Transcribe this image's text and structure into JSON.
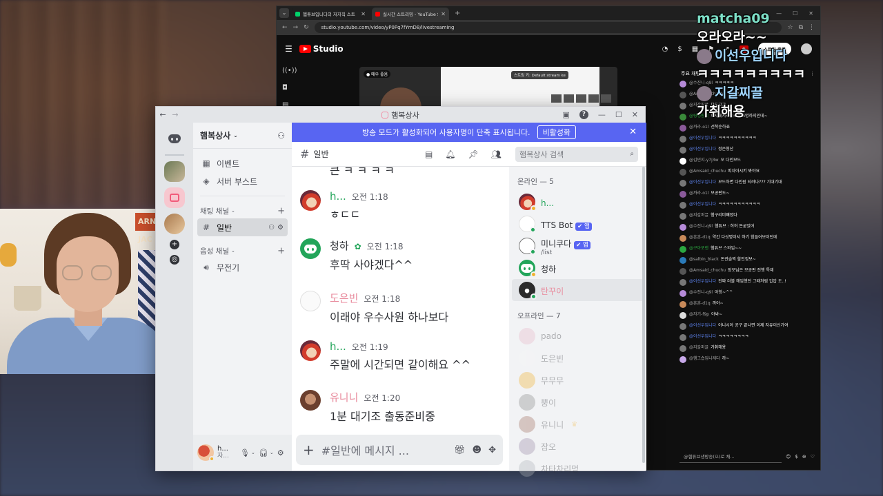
{
  "browser": {
    "tabs": [
      {
        "label": "헴튜브입니다의 저지직 스트",
        "color": "#00d26a"
      },
      {
        "label": "실시간 스트리밍 - YouTube St",
        "color": "#ff0000"
      }
    ],
    "url": "studio.youtube.com/video/yP0Pq7fYmD8/livestreaming",
    "logo_text": "Studio",
    "end_stream_label": "스트림 종료",
    "preview_status": "● 매우 좋음",
    "preview_stream_key": "스트림 키: Default stream ke",
    "chat_header": "주요 채팅",
    "chat_input_placeholder": "@헴튜브생방송(으)로 채..."
  },
  "youtube_chat": [
    {
      "name": "@수진니-q9l",
      "text": "ㅋㅋㅋㅋㅋ",
      "color": "#b58ad8",
      "kind": "normal"
    },
    {
      "name": "@Amsaid_chuchu",
      "text": "선착순시키죠",
      "color": "#555",
      "kind": "normal"
    },
    {
      "name": "@지갈퍼끌",
      "text": "모도고고",
      "color": "#777",
      "kind": "normal"
    },
    {
      "name": "@링탱랑했",
      "text": "피자데서리버리는 6명까지인데~",
      "color": "#3a8a3a",
      "kind": "member"
    },
    {
      "name": "@까라-o1l",
      "text": "선착순하죠",
      "color": "#8a5a9a",
      "kind": "normal"
    },
    {
      "name": "@이선우입니다",
      "text": "ㅋㅋㅋㅋㅋㅋㅋㅋㅋㅋ",
      "color": "#777",
      "kind": "mod"
    },
    {
      "name": "@이선우입니다",
      "text": "정은형산",
      "color": "#777",
      "kind": "mod"
    },
    {
      "name": "@김민지-y7j3w",
      "text": "오 다인모드",
      "color": "#fff",
      "kind": "normal"
    },
    {
      "name": "@Amsaid_chuchu",
      "text": "피자아시키 봐야요",
      "color": "#555",
      "kind": "normal"
    },
    {
      "name": "@이선우입니다",
      "text": "모드하면 다인원 되려나??? 기대기대",
      "color": "#777",
      "kind": "mod"
    },
    {
      "name": "@까라-o1l",
      "text": "모공판도~",
      "color": "#8a5a9a",
      "kind": "normal"
    },
    {
      "name": "@이선우입니다",
      "text": "ㅋㅋㅋㅋㅋㅋㅋㅋㅋㅋㅋ",
      "color": "#777",
      "kind": "mod"
    },
    {
      "name": "@지갈퍼끌",
      "text": "햄구리미빼졌다",
      "color": "#777",
      "kind": "normal"
    },
    {
      "name": "@수진니-q9l",
      "text": "햄튜브 : 허허 돈굳었어",
      "color": "#b58ad8",
      "kind": "normal"
    },
    {
      "name": "@혼혼-d1q",
      "text": "약간 다섯명이서 하기 힘들어보이던데",
      "color": "#c88a5a",
      "kind": "normal"
    },
    {
      "name": "@구아포랜",
      "text": "햄튜브 스와입~~",
      "color": "#2ba640",
      "kind": "member"
    },
    {
      "name": "@salbin_black",
      "text": "돈관슬찍 할인정보~",
      "color": "#2a7ab8",
      "kind": "normal"
    },
    {
      "name": "@Amsaid_chuchu",
      "text": "장모님은 모공판 진행 특제",
      "color": "#555",
      "kind": "normal"
    },
    {
      "name": "@이선우입니다",
      "text": "진짜 러볼 해임했던 그때처럼 압압 도..!",
      "color": "#777",
      "kind": "mod"
    },
    {
      "name": "@수진니-q9l",
      "text": "아항~^^",
      "color": "#b58ad8",
      "kind": "normal"
    },
    {
      "name": "@혼혼-d1q",
      "text": "까아~",
      "color": "#c88a5a",
      "kind": "normal"
    },
    {
      "name": "@자기-f9p",
      "text": "야싸~",
      "color": "#ddd",
      "kind": "normal"
    },
    {
      "name": "@이선우입니다",
      "text": "아니시아 공구 끝나면 이제 자유이신가여",
      "color": "#777",
      "kind": "mod"
    },
    {
      "name": "@이선우입니다",
      "text": "ㅋㅋㅋㅋㅋㅋㅋㅋ",
      "color": "#777",
      "kind": "mod"
    },
    {
      "name": "@지갈퍼끌",
      "text": "가취해용",
      "color": "#777",
      "kind": "normal"
    },
    {
      "name": "@햄그숍입니제다",
      "text": "까~",
      "color": "#c7a8e8",
      "kind": "normal"
    }
  ],
  "overlay": {
    "line1_name": "matcha09",
    "line2": "오라오라~~",
    "line3": "이선우입니다",
    "line4": "ㅋㅋㅋㅋㅋㅋㅋㅋㅋ",
    "line5": "지갈찌끌",
    "line6": "가취해용"
  },
  "webcam": {
    "sign_text": "ARNE JAC"
  },
  "discord": {
    "window_title": "햄복상사",
    "server_name": "햄복상사",
    "banner_text": "방송 모드가 활성화되어 사용자명이 단축 표시됩니다.",
    "banner_button": "비활성화",
    "nav": [
      {
        "label": "이벤트",
        "icon": "calendar-icon"
      },
      {
        "label": "서버 부스트",
        "icon": "boost-icon"
      }
    ],
    "text_category": "채팅 채널",
    "voice_category": "음성 채널",
    "text_channel": "일반",
    "voice_channel": "무전기",
    "channel_header": "일반",
    "search_placeholder": "햄복상사 검색",
    "composer_placeholder": "#일반에 메시지 ...",
    "user": {
      "name": "h...",
      "sub": "자..."
    },
    "cutoff_text": "큰 ㅋ ㅋ ㅋ ㅋ",
    "messages": [
      {
        "author": "h...",
        "time": "오전 1:18",
        "text": "ㅎㄷㄷ",
        "author_color": "#23a55a",
        "avatar": "av-h"
      },
      {
        "author": "청하",
        "time": "오전 1:18",
        "text": "후딱 사야겠다^^",
        "author_color": "#313338",
        "avatar": "av-disc",
        "badge": "✿"
      },
      {
        "author": "도은빈",
        "time": "오전 1:18",
        "text": "이래야 우수사원 하나보다",
        "author_color": "#e88a9c",
        "avatar": "av-sketch"
      },
      {
        "author": "h...",
        "time": "오전 1:19",
        "text": "주말에 시간되면 같이해요 ^^",
        "author_color": "#23a55a",
        "avatar": "av-h"
      },
      {
        "author": "유니니",
        "time": "오전 1:20",
        "text": "1분 대기조 출동준비중",
        "author_color": "#e88a9c",
        "avatar": "av-uni"
      }
    ],
    "online_header": "온라인 — 5",
    "offline_header": "오프라인 — 7",
    "online": [
      {
        "name": "h...",
        "sub": "",
        "status": "#f0b232",
        "avatar": "av-h",
        "name_color": "#23a55a",
        "tag": ""
      },
      {
        "name": "TTS Bot",
        "sub": "",
        "status": "#23a55a",
        "avatar": "bot1",
        "name_color": "#313338",
        "tag": "✔ 앱"
      },
      {
        "name": "미니쿠다",
        "sub": "/list",
        "status": "#23a55a",
        "avatar": "bot2",
        "name_color": "#313338",
        "tag": "✔ 앱"
      },
      {
        "name": "청하",
        "sub": "",
        "status": "#f0b232",
        "avatar": "av-disc",
        "name_color": "#313338",
        "tag": ""
      },
      {
        "name": "탄꾸이",
        "sub": "",
        "status": "#23a55a",
        "avatar": "cat",
        "name_color": "#e88a9c",
        "tag": ""
      }
    ],
    "offline": [
      {
        "name": "pado",
        "avatar": "#e8b8c8"
      },
      {
        "name": "도은빈",
        "avatar": "#f5f5f5"
      },
      {
        "name": "무무무",
        "avatar": "#f0b232"
      },
      {
        "name": "뿡이",
        "avatar": "#8a8a8a"
      },
      {
        "name": "유니니",
        "avatar": "#a07060",
        "crown": "♛"
      },
      {
        "name": "잠오",
        "avatar": "#9a8aa8"
      },
      {
        "name": "차타차리멍",
        "avatar": "#b0b4ba"
      }
    ]
  }
}
